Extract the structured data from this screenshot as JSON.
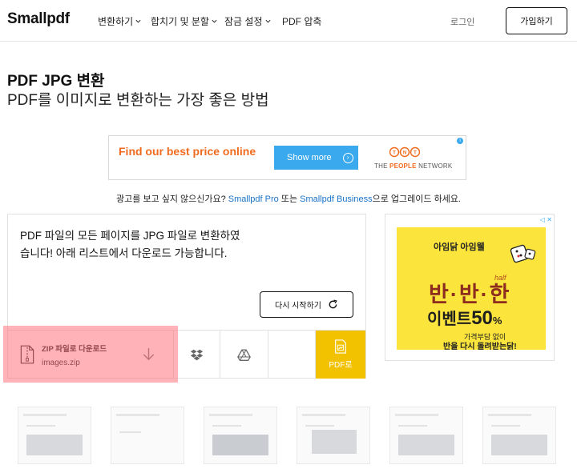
{
  "nav": {
    "logo": "Smallpdf",
    "items": [
      "변환하기",
      "합치기 및 분할",
      "잠금 설정",
      "PDF 압축"
    ],
    "login": "로그인",
    "signup": "가입하기"
  },
  "heading": {
    "title": "PDF JPG 변환",
    "subtitle": "PDF를 이미지로 변환하는 가장 좋은 방법"
  },
  "ad": {
    "headline": "Find our best price online",
    "button": "Show more",
    "brand_logo": "TNT",
    "brand_sub_1": "THE ",
    "brand_sub_2": "PEOPLE",
    "brand_sub_3": " NETWORK",
    "adchoice": "i"
  },
  "ad_note": {
    "part1": "광고를 보고 싶지 않으신가요? ",
    "link1": "Smallpdf Pro",
    "part2": " 또는 ",
    "link2": "Smallpdf Business",
    "part3": "으로 업그레이드 하세요."
  },
  "result": {
    "message": "PDF 파일의 모든 페이지를 JPG 파일로 변환하였습니다! 아래 리스트에서 다운로드 가능합니다.",
    "restart": "다시 시작하기",
    "download_title": "ZIP 파일로 다운로드",
    "download_file": "images.zip",
    "pdf_to": "PDF로"
  },
  "side_ad": {
    "brand": "아임닭  아임웰",
    "half": "half",
    "big": "반·반·한",
    "event": "이벤트",
    "percent": "50",
    "percent_sign": "%",
    "line1": "가격부담 없이",
    "line2": "반을 다시 돌려받는닭!",
    "choice": "◁ ✕"
  },
  "colors": {
    "accent_yellow": "#f2c200",
    "ad_orange": "#f06b1e",
    "ad_blue": "#3aa9ee",
    "link_blue": "#1a73c8",
    "highlight": "#ff6e78"
  }
}
